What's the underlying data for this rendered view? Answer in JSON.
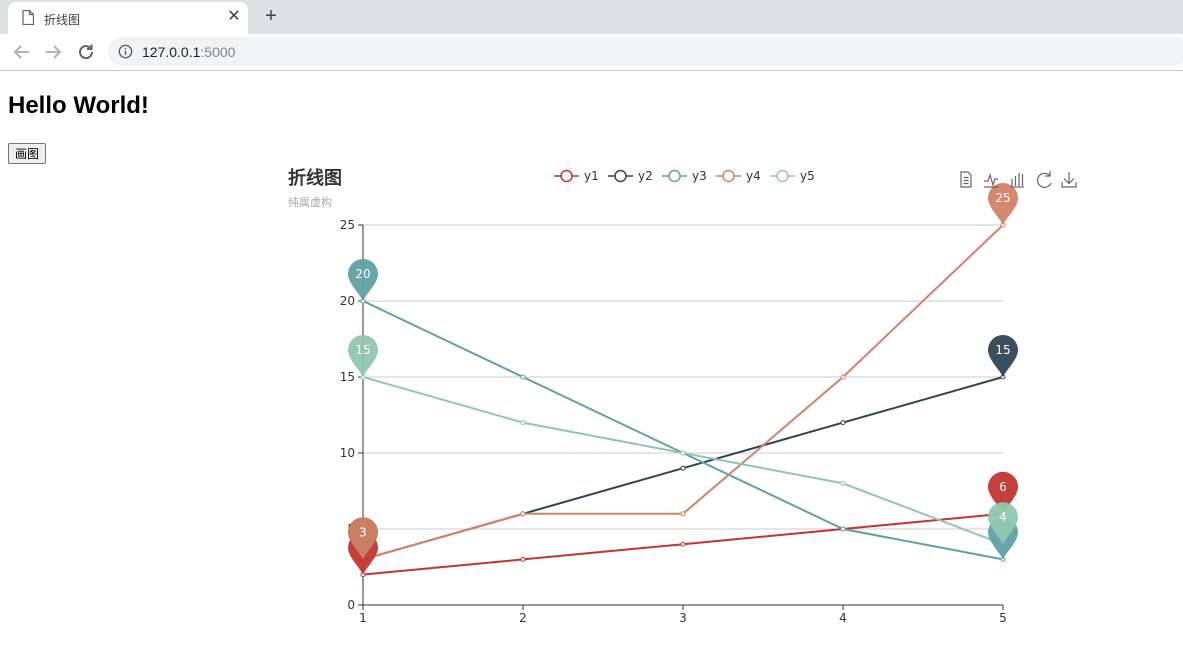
{
  "browser": {
    "tab_title": "折线图",
    "url_host": "127.0.0.1",
    "url_port": ":5000"
  },
  "page": {
    "heading": "Hello World!",
    "button_label": "画图"
  },
  "chart_data": {
    "type": "line",
    "title": "折线图",
    "subtitle": "纯属虚构",
    "x": [
      1,
      2,
      3,
      4,
      5
    ],
    "xlim": [
      1,
      5
    ],
    "ylim": [
      0,
      25
    ],
    "yticks": [
      0,
      5,
      10,
      15,
      20,
      25
    ],
    "grid": "horizontal",
    "legend_position": "top-center",
    "series": [
      {
        "name": "y1",
        "color": "#c23531",
        "values": [
          2,
          3,
          4,
          5,
          6
        ],
        "markers": [
          {
            "type": "min",
            "value": 2
          },
          {
            "type": "max",
            "value": 6
          }
        ]
      },
      {
        "name": "y2",
        "color": "#2f4554",
        "values": [
          3,
          6,
          9,
          12,
          15
        ],
        "markers": [
          {
            "type": "min",
            "value": 3
          },
          {
            "type": "max",
            "value": 15
          }
        ]
      },
      {
        "name": "y3",
        "color": "#61a0a8",
        "values": [
          20,
          15,
          10,
          5,
          3
        ],
        "markers": [
          {
            "type": "max",
            "value": 20
          },
          {
            "type": "min",
            "value": 3
          }
        ]
      },
      {
        "name": "y4",
        "color": "#d48265",
        "values": [
          3,
          6,
          6,
          15,
          25
        ],
        "markers": [
          {
            "type": "min",
            "value": 3
          },
          {
            "type": "max",
            "value": 25
          }
        ]
      },
      {
        "name": "y5",
        "color": "#91c7ae",
        "values": [
          15,
          12,
          10,
          8,
          4
        ],
        "markers": [
          {
            "type": "max",
            "value": 15
          },
          {
            "type": "min",
            "value": 4
          }
        ]
      }
    ],
    "toolbox": [
      "data-view",
      "line-switch",
      "bar-switch",
      "restore",
      "save-image"
    ]
  }
}
